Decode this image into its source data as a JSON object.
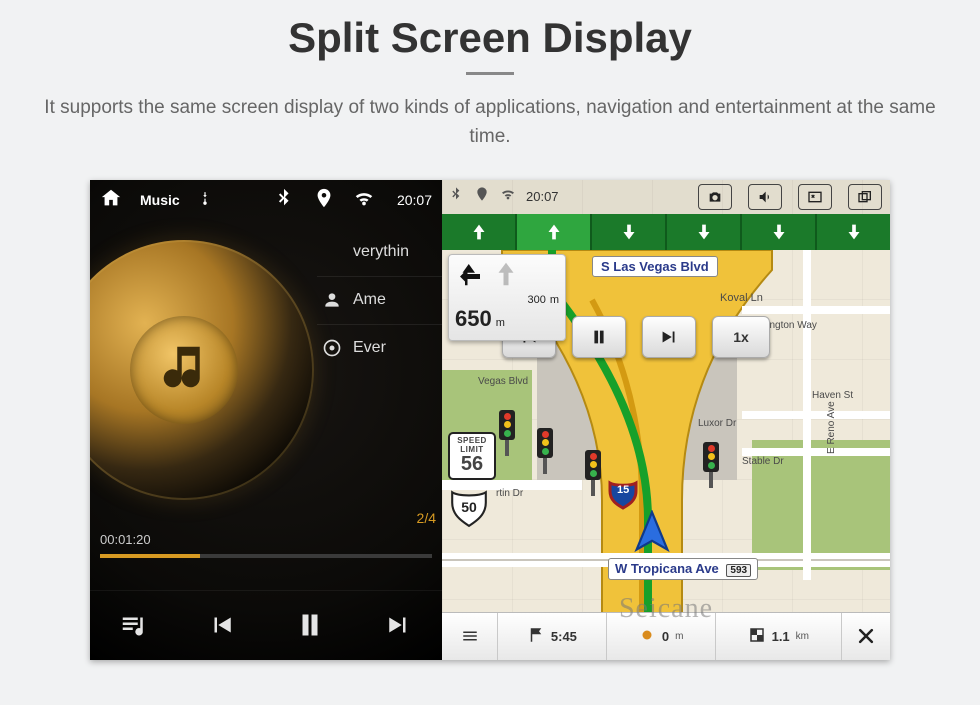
{
  "page": {
    "title": "Split Screen Display",
    "description": "It supports the same screen display of two kinds of applications, navigation and entertainment at the same time."
  },
  "music": {
    "status": {
      "title": "Music",
      "time": "20:07"
    },
    "now_playing_partial": "verythin",
    "tracks": [
      {
        "icon": "person",
        "label": "Ame"
      },
      {
        "icon": "target",
        "label": "Ever"
      }
    ],
    "counter": "2/4",
    "elapsed": "00:01:20",
    "progress_pct": 30
  },
  "nav": {
    "status_time": "20:07",
    "lane_count": 6,
    "lane_active_index": 1,
    "instruction": {
      "dist_small": "300",
      "dist_small_unit": "m",
      "dist_big": "650",
      "dist_big_unit": "m"
    },
    "street_top": "S Las Vegas Blvd",
    "dvr_speed_label": "1x",
    "speed_limit": {
      "label": "SPEED LIMIT",
      "value": "56"
    },
    "shield_route": "50",
    "street_bottom": {
      "name": "W Tropicana Ave",
      "tag": "593"
    },
    "interstate": "15",
    "map_labels": {
      "koval": "Koval Ln",
      "duke": "Duke Ellington Way",
      "vegas": "Vegas Blvd",
      "haven": "Haven St",
      "luxor": "Luxor Dr",
      "reno": "E Reno Ave",
      "stable": "Stable Dr",
      "martin": "rtin Dr"
    },
    "bottom": {
      "eta": "5:45",
      "stop_dist": "0",
      "stop_unit": "m",
      "dest_dist": "1.1",
      "dest_unit": "km"
    },
    "watermark": "Seicane"
  }
}
